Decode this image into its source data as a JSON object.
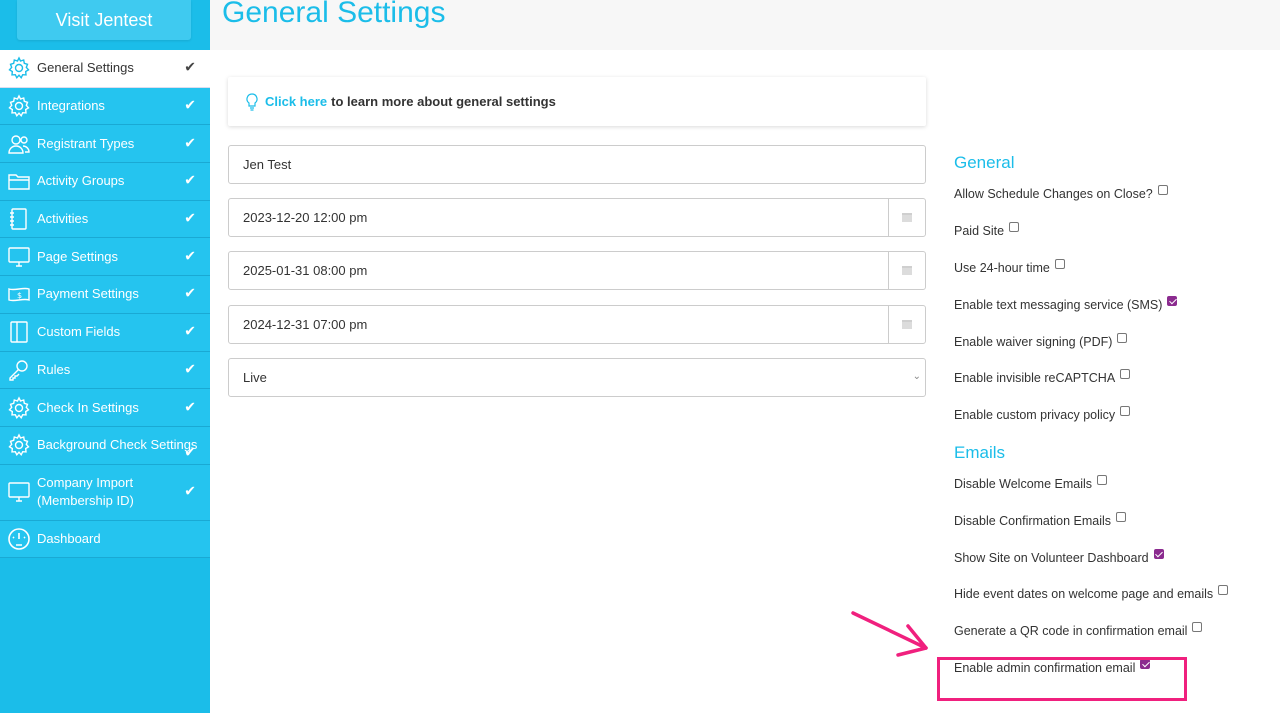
{
  "sidebar": {
    "visit_label": "Visit Jentest",
    "items": [
      {
        "label": "General Settings",
        "icon": "gear-icon"
      },
      {
        "label": "Integrations",
        "icon": "gear-icon"
      },
      {
        "label": "Registrant Types",
        "icon": "users-icon"
      },
      {
        "label": "Activity Groups",
        "icon": "folder-icon"
      },
      {
        "label": "Activities",
        "icon": "notebook-icon"
      },
      {
        "label": "Page Settings",
        "icon": "monitor-icon"
      },
      {
        "label": "Payment Settings",
        "icon": "money-icon"
      },
      {
        "label": "Custom Fields",
        "icon": "book-icon"
      },
      {
        "label": "Rules",
        "icon": "key-icon"
      },
      {
        "label": "Check In Settings",
        "icon": "gear-icon"
      },
      {
        "label": "Background Check Settings",
        "icon": "gear-icon"
      },
      {
        "label": "Company Import (Membership ID)",
        "icon": "monitor-icon"
      },
      {
        "label": "Dashboard",
        "icon": "dashboard-icon"
      }
    ],
    "check_glyph": "✔"
  },
  "header": {
    "title": "General Settings"
  },
  "info": {
    "link": "Click here",
    "text": "to learn more about general settings"
  },
  "form": {
    "name": "Jen Test",
    "start_date": "2023-12-20 12:00 pm",
    "end_date": "2025-01-31 08:00 pm",
    "close_date": "2024-12-31 07:00 pm",
    "status": "Live"
  },
  "general": {
    "title": "General",
    "options": [
      {
        "label": "Allow Schedule Changes on Close?",
        "checked": false
      },
      {
        "label": "Paid Site",
        "checked": false
      },
      {
        "label": "Use 24-hour time",
        "checked": false
      },
      {
        "label": "Enable text messaging service (SMS)",
        "checked": true
      },
      {
        "label": "Enable waiver signing (PDF)",
        "checked": false
      },
      {
        "label": "Enable invisible reCAPTCHA",
        "checked": false
      },
      {
        "label": "Enable custom privacy policy",
        "checked": false
      }
    ]
  },
  "emails": {
    "title": "Emails",
    "options": [
      {
        "label": "Disable Welcome Emails",
        "checked": false
      },
      {
        "label": "Disable Confirmation Emails",
        "checked": false
      },
      {
        "label": "Show Site on Volunteer Dashboard",
        "checked": true
      },
      {
        "label": "Hide event dates on welcome page and emails",
        "checked": false
      },
      {
        "label": "Generate a QR code in confirmation email",
        "checked": false
      },
      {
        "label": "Enable admin confirmation email",
        "checked": true
      }
    ]
  },
  "colors": {
    "accent": "#1bbde9",
    "checkbox": "#8b2b8f",
    "highlight": "#f0207e"
  }
}
